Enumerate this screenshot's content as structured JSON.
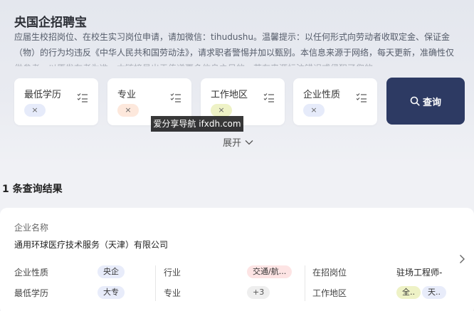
{
  "app": {
    "title": "央国企招聘宝",
    "notice": "应届生校招岗位、在校生实习岗位申请，请加微信：tihudushu。温馨提示：以任何形式向劳动者收取定金、保证金（物）的行为均违反《中华人民共和国劳动法》，请求职者警惕并加以甄别。本信息来源于网络，每天更新，准确性仅供参考，以原发布者为准。本链接是出于传递更多信息之目的。若有来源标注错误或侵犯了您的"
  },
  "filters": [
    {
      "label": "最低学历",
      "chip": "×",
      "chip_color": "#e6ebfa"
    },
    {
      "label": "专业",
      "chip": "×",
      "chip_color": "#fde8dc"
    },
    {
      "label": "工作地区",
      "chip": "×",
      "chip_color": "#eef2c6"
    },
    {
      "label": "企业性质",
      "chip": "×",
      "chip_color": "#e6ebfa"
    }
  ],
  "search": {
    "label": "查询",
    "color": "#2d3a63"
  },
  "watermark": "爱分享导航 ifxdh.com",
  "expand": {
    "label": "展开"
  },
  "results": {
    "count_text": "1 条查询结果"
  },
  "card": {
    "company_label": "企业名称",
    "company_name": "通用环球医疗技术服务（天津）有限公司",
    "rows": [
      {
        "nature_label": "企业性质",
        "nature_value": "央企",
        "industry_label": "行业",
        "industry_value": "交通/航...",
        "position_label": "在招岗位",
        "position_value": "驻场工程师-"
      },
      {
        "edu_label": "最低学历",
        "edu_value": "大专",
        "major_label": "专业",
        "major_value": "+3",
        "region_label": "工作地区",
        "region_value1": "全..",
        "region_value2": "天.."
      }
    ]
  }
}
